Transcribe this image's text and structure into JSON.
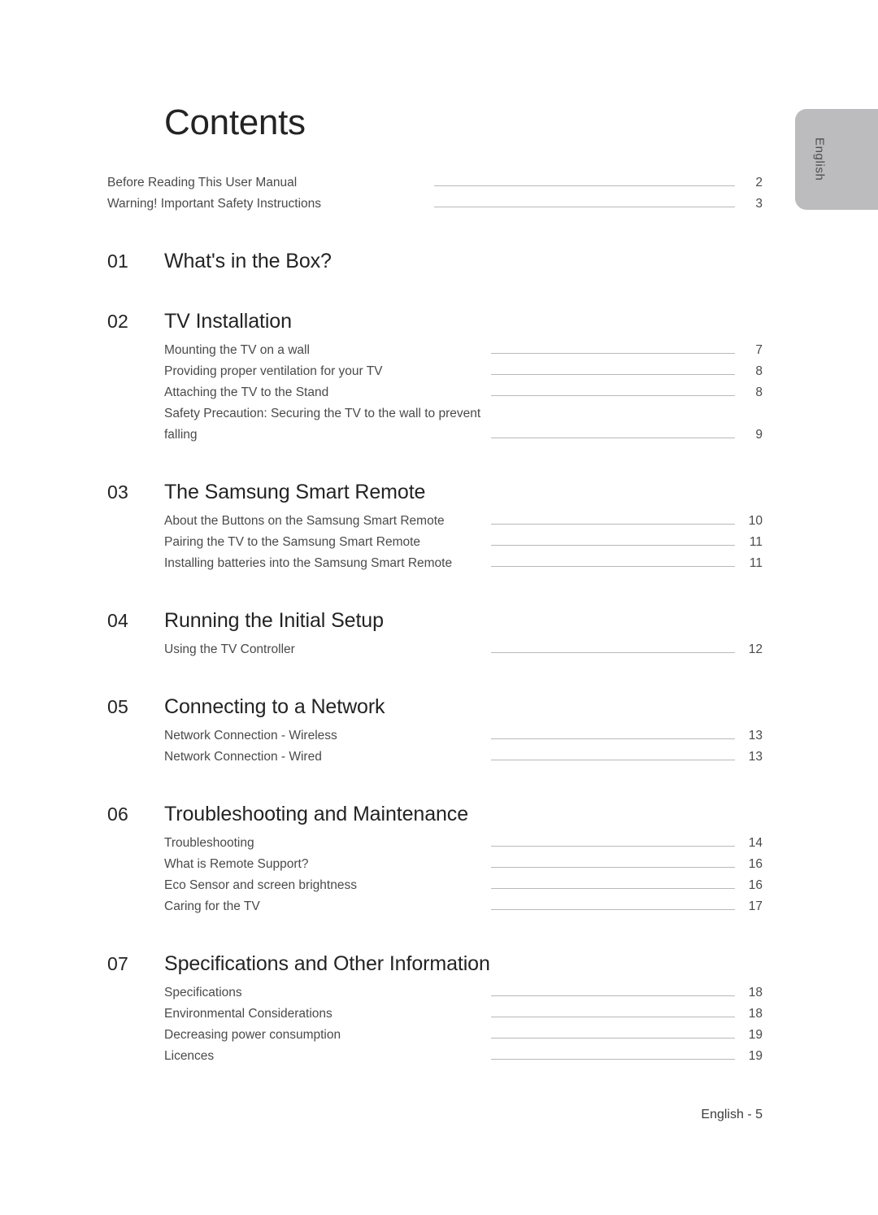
{
  "side_tab": {
    "label": "English"
  },
  "heading": {
    "title": "Contents"
  },
  "front_matter": [
    {
      "label": "Before Reading This User Manual",
      "page": "2"
    },
    {
      "label": "Warning! Important Safety Instructions",
      "page": "3"
    }
  ],
  "chapters": [
    {
      "number": "01",
      "title": "What's in the Box?",
      "entries": []
    },
    {
      "number": "02",
      "title": "TV Installation",
      "entries": [
        {
          "label": "Mounting the TV on a wall",
          "page": "7"
        },
        {
          "label": "Providing proper ventilation for your TV",
          "page": "8"
        },
        {
          "label": "Attaching the TV to the Stand",
          "page": "8"
        },
        {
          "label": "Safety Precaution: Securing the TV to the wall to prevent falling",
          "page": "9",
          "two_line": true
        }
      ]
    },
    {
      "number": "03",
      "title": "The Samsung Smart Remote",
      "entries": [
        {
          "label": "About the Buttons on the Samsung Smart Remote",
          "page": "10"
        },
        {
          "label": "Pairing the TV to the Samsung Smart Remote",
          "page": "11"
        },
        {
          "label": "Installing batteries into the Samsung Smart Remote",
          "page": "11"
        }
      ]
    },
    {
      "number": "04",
      "title": "Running the Initial Setup",
      "entries": [
        {
          "label": "Using the TV Controller",
          "page": "12"
        }
      ]
    },
    {
      "number": "05",
      "title": "Connecting to a Network",
      "entries": [
        {
          "label": "Network Connection - Wireless",
          "page": "13"
        },
        {
          "label": "Network Connection - Wired",
          "page": "13"
        }
      ]
    },
    {
      "number": "06",
      "title": "Troubleshooting and Maintenance",
      "entries": [
        {
          "label": "Troubleshooting",
          "page": "14"
        },
        {
          "label": "What is Remote Support?",
          "page": "16"
        },
        {
          "label": "Eco Sensor and screen brightness",
          "page": "16"
        },
        {
          "label": "Caring for the TV",
          "page": "17"
        }
      ]
    },
    {
      "number": "07",
      "title": "Specifications and Other Information",
      "entries": [
        {
          "label": "Specifications",
          "page": "18"
        },
        {
          "label": "Environmental Considerations",
          "page": "18"
        },
        {
          "label": "Decreasing power consumption",
          "page": "19"
        },
        {
          "label": "Licences",
          "page": "19"
        }
      ]
    }
  ],
  "footer": {
    "text": "English - 5"
  },
  "colors": {
    "tab_background": "#bcbcbe",
    "heading_text": "#232323",
    "body_text": "#4a4a4a",
    "leader_line": "#b9b9bd"
  }
}
